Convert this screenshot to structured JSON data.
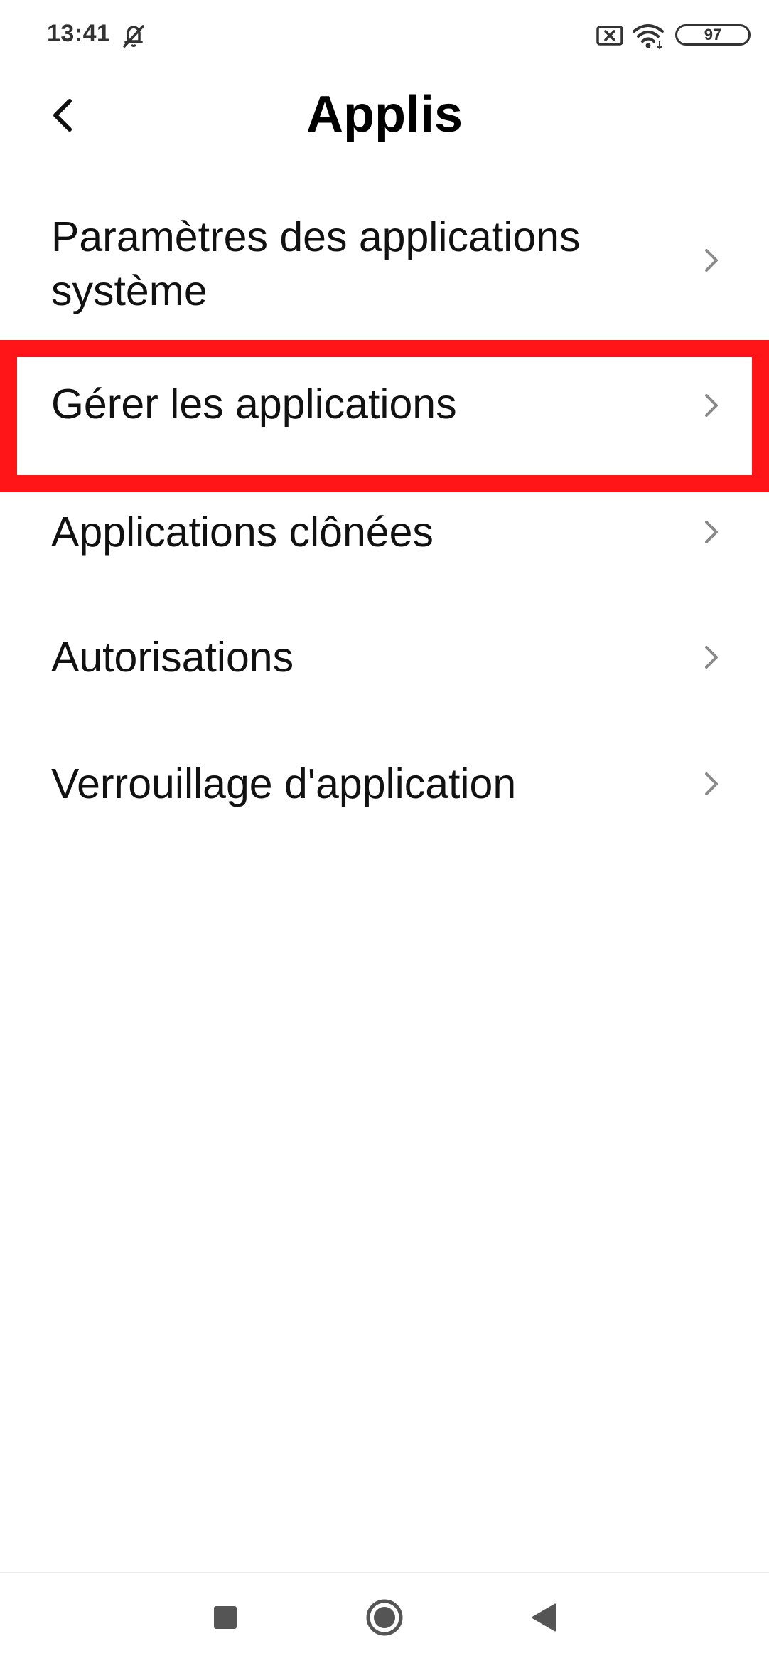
{
  "status_bar": {
    "time": "13:41",
    "battery_level": "97",
    "icons": [
      "silent-bell-icon",
      "no-sim-icon",
      "wifi-icon",
      "battery-icon"
    ]
  },
  "header": {
    "title": "Applis",
    "back_icon": "chevron-left-icon"
  },
  "menu": {
    "items": [
      {
        "label": "Paramètres des applications système"
      },
      {
        "label": "Gérer les applications"
      },
      {
        "label": "Applications clônées"
      },
      {
        "label": "Autorisations"
      },
      {
        "label": "Verrouillage d'application"
      }
    ]
  },
  "annotation": {
    "highlight_color": "#ff1418"
  },
  "nav_bar": {
    "buttons": [
      "recent-apps-icon",
      "home-icon",
      "back-triangle-icon"
    ]
  }
}
